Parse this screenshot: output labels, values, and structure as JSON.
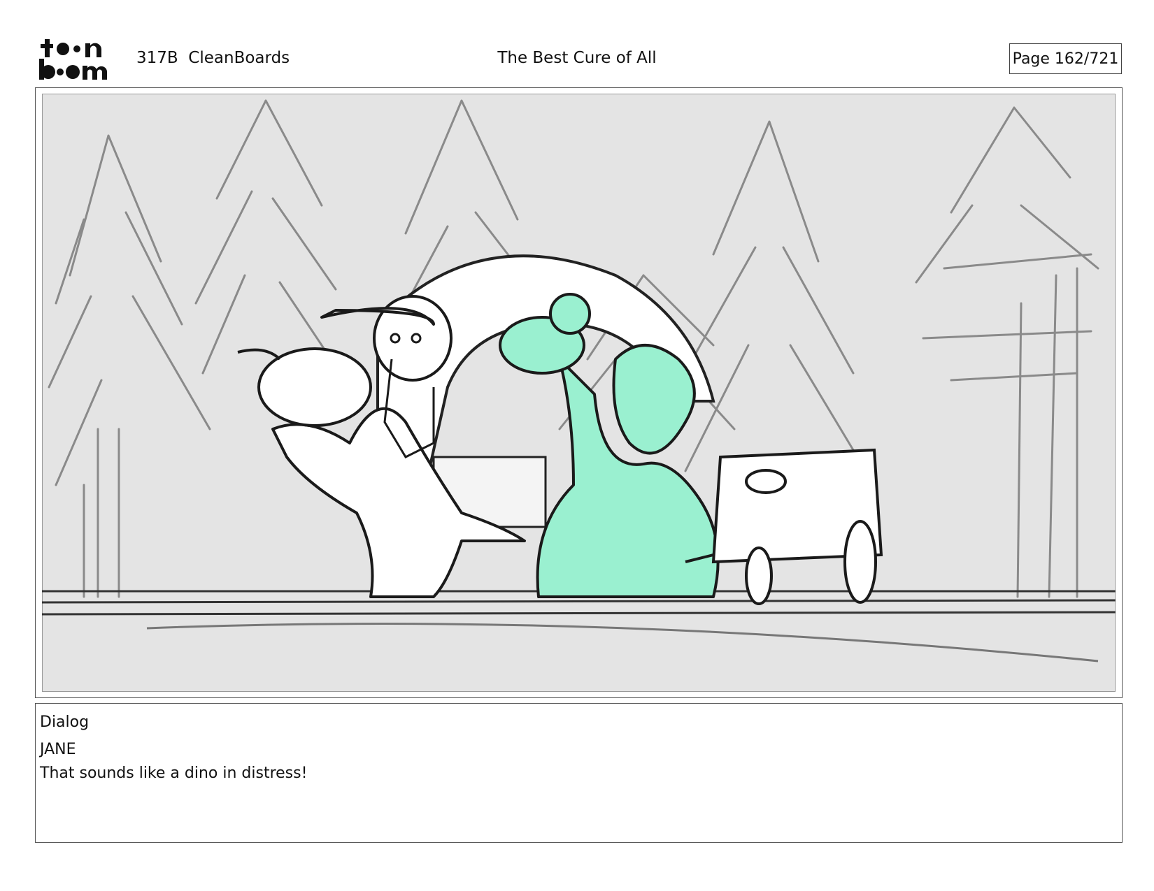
{
  "header": {
    "logo_text": "toonboom",
    "project": "317B  CleanBoards",
    "title": "The Best Cure of All",
    "page": "Page 162/721"
  },
  "panel": {
    "colors": {
      "background": "#e4e4e4",
      "highlight_character": "#9af0d0",
      "line": "#1a1a1a",
      "trees": "#8a8a8a"
    }
  },
  "dialog": {
    "label": "Dialog",
    "speaker": "JANE",
    "line": "That sounds like a dino in distress!"
  }
}
